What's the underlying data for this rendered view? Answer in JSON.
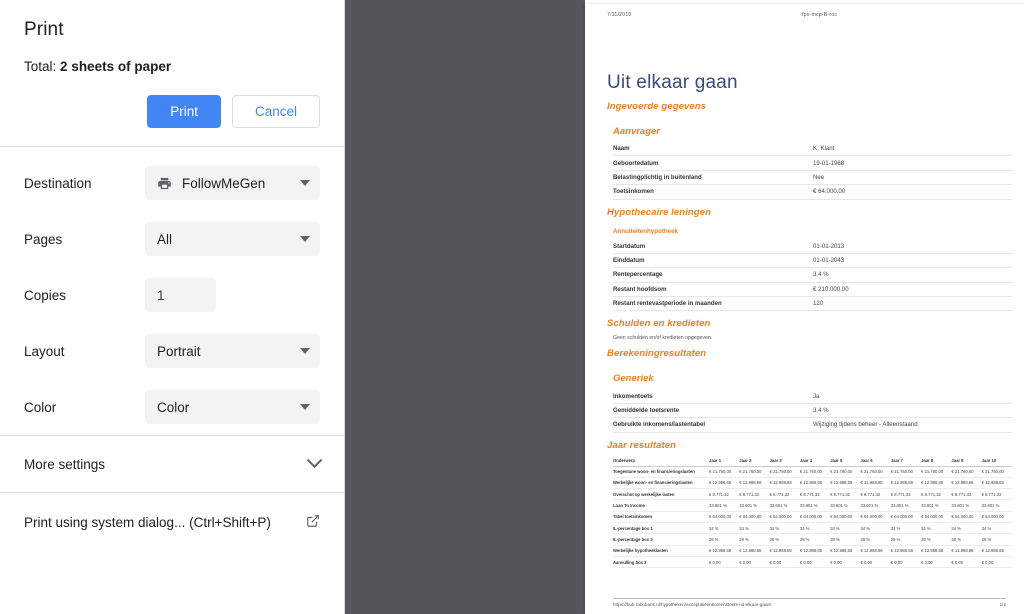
{
  "dialog": {
    "title": "Print",
    "total_prefix": "Total:",
    "total_value": "2 sheets of paper",
    "print_button": "Print",
    "cancel_button": "Cancel",
    "accent_color": "#4285f4",
    "settings": [
      {
        "label": "Destination",
        "value": "FollowMeGen",
        "control": "select",
        "icon": "printer-icon",
        "name": "destination"
      },
      {
        "label": "Pages",
        "value": "All",
        "control": "select",
        "name": "pages"
      },
      {
        "label": "Copies",
        "value": "1",
        "control": "input",
        "name": "copies"
      },
      {
        "label": "Layout",
        "value": "Portrait",
        "control": "select",
        "name": "layout"
      },
      {
        "label": "Color",
        "value": "Color",
        "control": "select",
        "name": "color"
      }
    ],
    "more_settings_label": "More settings",
    "system_dialog_label": "Print using system dialog... (Ctrl+Shift+P)"
  },
  "preview": {
    "header": {
      "date": "7/11/2019",
      "doc_id": "fpx-mcp-B-roc"
    },
    "title": "Uit elkaar gaan",
    "section_ingevoerde": "Ingevoerde gegevens",
    "sub_aanvrager": "Aanvrager",
    "aanvrager_rows": [
      {
        "k": "Naam",
        "v": "K. Klant"
      },
      {
        "k": "Geboortedatum",
        "v": "19-01-1968"
      },
      {
        "k": "Belastingplichtig in buitenland",
        "v": "Nee"
      },
      {
        "k": "Toetsinkomen",
        "v": "€ 64.000,00"
      }
    ],
    "section_hypothecaire": "Hypothecaire leningen",
    "sub_annuiteiten": "Annuiteitenhypotheek",
    "annuiteiten_rows": [
      {
        "k": "Startdatum",
        "v": "01-01-2013"
      },
      {
        "k": "Einddatum",
        "v": "01-01-2043"
      },
      {
        "k": "Rentepercentage",
        "v": "3,4 %"
      },
      {
        "k": "Restant hoofdsom",
        "v": "€ 210.000,00"
      },
      {
        "k": "Restant rentevastperiode in maanden",
        "v": "120"
      }
    ],
    "section_schulden": "Schulden en kredieten",
    "schulden_note": "Geen schulden en/of kredieten opgegeven.",
    "section_berekening": "Berekeningresultaten",
    "sub_generiek": "Generiek",
    "generiek_rows": [
      {
        "k": "Inkomentoets",
        "v": "Ja"
      },
      {
        "k": "Gemiddelde toetsrente",
        "v": "3,4 %"
      },
      {
        "k": "Gebruikte inkomens/lastentabel",
        "v": "Wijziging tijdens beheer - Alleenstaand"
      }
    ],
    "section_jaar": "Jaar resultaten",
    "jaar_table": {
      "columns": [
        "Onderwerp",
        "Jaar 1",
        "Jaar 2",
        "Jaar 3",
        "Jaar 4",
        "Jaar 5",
        "Jaar 6",
        "Jaar 7",
        "Jaar 8",
        "Jaar 9",
        "Jaar 10"
      ],
      "rows": [
        {
          "label": "Toegestane woon- en financieringslasten",
          "values": [
            "€ 21.760,00",
            "€ 21.760,00",
            "€ 21.760,00",
            "€ 21.760,00",
            "€ 21.760,00",
            "€ 21.760,00",
            "€ 21.760,00",
            "€ 21.760,00",
            "€ 21.760,00",
            "€ 21.760,00"
          ]
        },
        {
          "label": "Werkelijke woon- en financieringslasten",
          "values": [
            "€ 12.988,68",
            "€ 12.988,68",
            "€ 12.988,68",
            "€ 12.988,68",
            "€ 12.988,68",
            "€ 12.988,68",
            "€ 12.988,68",
            "€ 12.988,68",
            "€ 12.988,68",
            "€ 12.988,68"
          ]
        },
        {
          "label": "Overschot op werkelijke lasten",
          "values": [
            "€ 8.771,32",
            "€ 8.771,32",
            "€ 8.771,32",
            "€ 8.771,32",
            "€ 8.771,32",
            "€ 8.771,32",
            "€ 8.771,32",
            "€ 8.771,32",
            "€ 8.771,32",
            "€ 8.771,32"
          ]
        },
        {
          "label": "Loan To Income",
          "values": [
            "33.601 %",
            "33.601 %",
            "33.601 %",
            "33.601 %",
            "33.601 %",
            "33.601 %",
            "33.601 %",
            "33.601 %",
            "33.601 %",
            "33.601 %"
          ]
        },
        {
          "label": "Tabel toetsinkomen",
          "values": [
            "€ 64.000,00",
            "€ 64.000,00",
            "€ 64.000,00",
            "€ 64.000,00",
            "€ 64.000,00",
            "€ 64.000,00",
            "€ 64.000,00",
            "€ 64.000,00",
            "€ 64.000,00",
            "€ 64.000,00"
          ]
        },
        {
          "label": "IL-percentage box 1",
          "values": [
            "34 %",
            "34 %",
            "34 %",
            "34 %",
            "34 %",
            "34 %",
            "34 %",
            "34 %",
            "34 %",
            "34 %"
          ]
        },
        {
          "label": "IL-percentage box 3",
          "values": [
            "28 %",
            "28 %",
            "28 %",
            "28 %",
            "28 %",
            "28 %",
            "28 %",
            "28 %",
            "28 %",
            "28 %"
          ]
        },
        {
          "label": "Werkelijke hypotheeklasten",
          "values": [
            "€ 12.988,68",
            "€ 12.988,68",
            "€ 12.988,68",
            "€ 12.988,68",
            "€ 12.988,68",
            "€ 12.988,68",
            "€ 12.988,68",
            "€ 12.988,68",
            "€ 12.988,68",
            "€ 12.988,68"
          ]
        },
        {
          "label": "Aanvulling box 3",
          "values": [
            "€ 0,00",
            "€ 0,00",
            "€ 0,00",
            "€ 0,00",
            "€ 0,00",
            "€ 0,00",
            "€ 0,00",
            "€ 0,00",
            "€ 0,00",
            "€ 0,00"
          ]
        }
      ]
    },
    "footer": {
      "url": "https://hub.rabobank.nl/hypotheken/acceptatie/inkomenstoets-uit-elkaar-gaan/",
      "page": "1/2"
    }
  }
}
